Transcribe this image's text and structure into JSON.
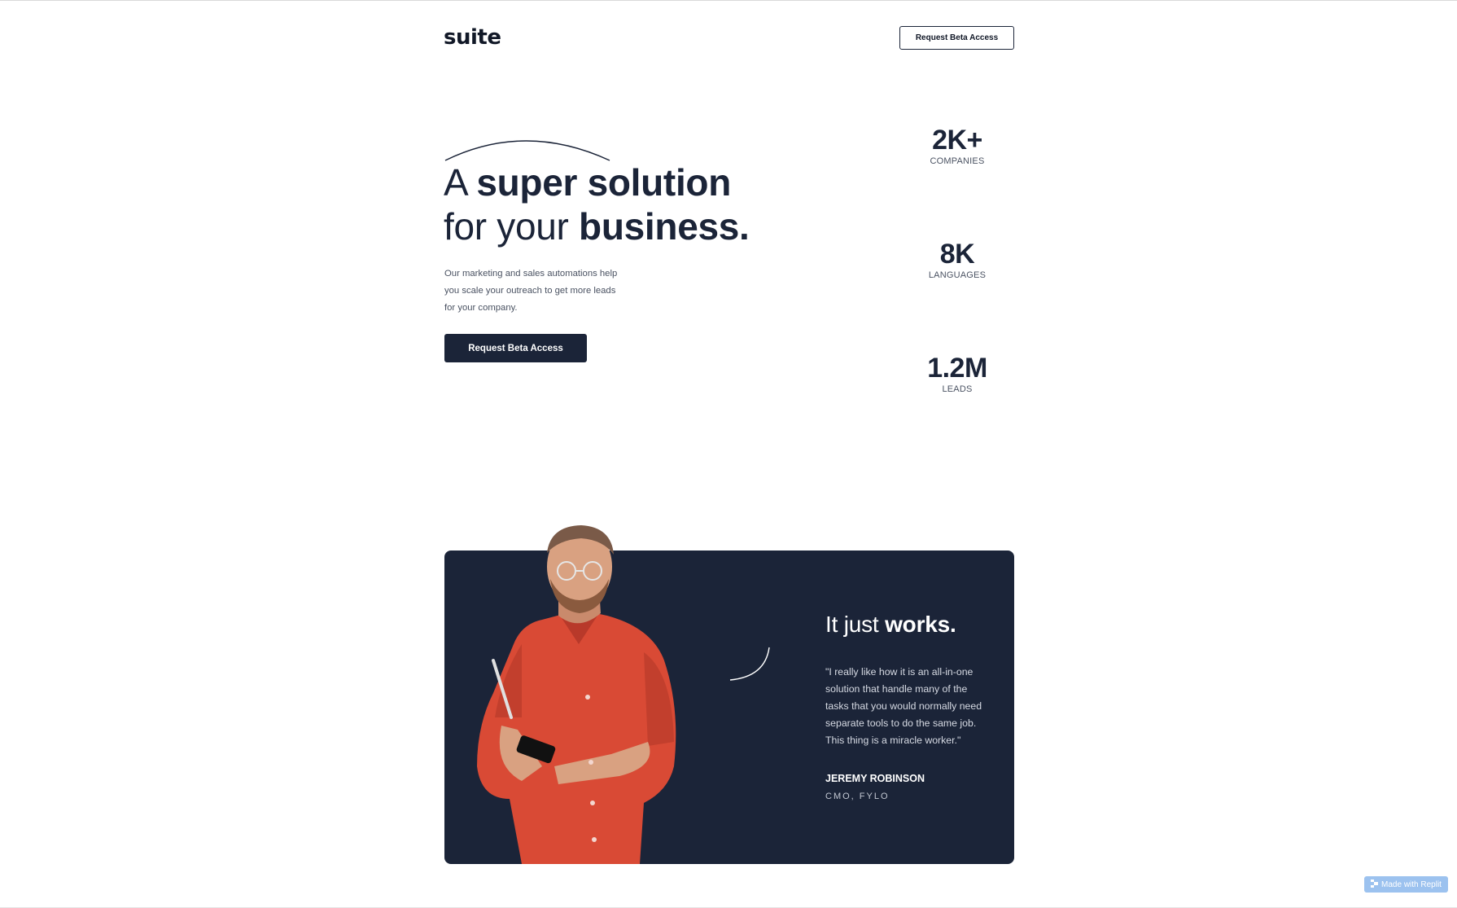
{
  "header": {
    "logo": "suite",
    "cta_label": "Request Beta Access"
  },
  "hero": {
    "headline_line1_light": "A ",
    "headline_line1_bold": "super solution",
    "headline_line2_light": "for your ",
    "headline_line2_bold": "business.",
    "description": "Our marketing and sales automations help you scale your outreach to get more leads for your company.",
    "cta_label": "Request Beta Access"
  },
  "stats": [
    {
      "value": "2K+",
      "label": "COMPANIES"
    },
    {
      "value": "8K",
      "label": "LANGUAGES"
    },
    {
      "value": "1.2M",
      "label": "LEADS"
    }
  ],
  "testimonial": {
    "title_light": "It just ",
    "title_bold": "works.",
    "quote": "\"I really like how it is an all-in-one solution that handle many of the tasks that you would normally need separate tools to do the same job. This thing is a miracle worker.\"",
    "author": "JEREMY ROBINSON",
    "role": "CMO, FYLO"
  },
  "badge": {
    "label": "Made with Replit",
    "icon": "replit-icon"
  },
  "colors": {
    "navy": "#1b2438",
    "shirt": "#d94a35",
    "badge": "#9cc2ef"
  }
}
